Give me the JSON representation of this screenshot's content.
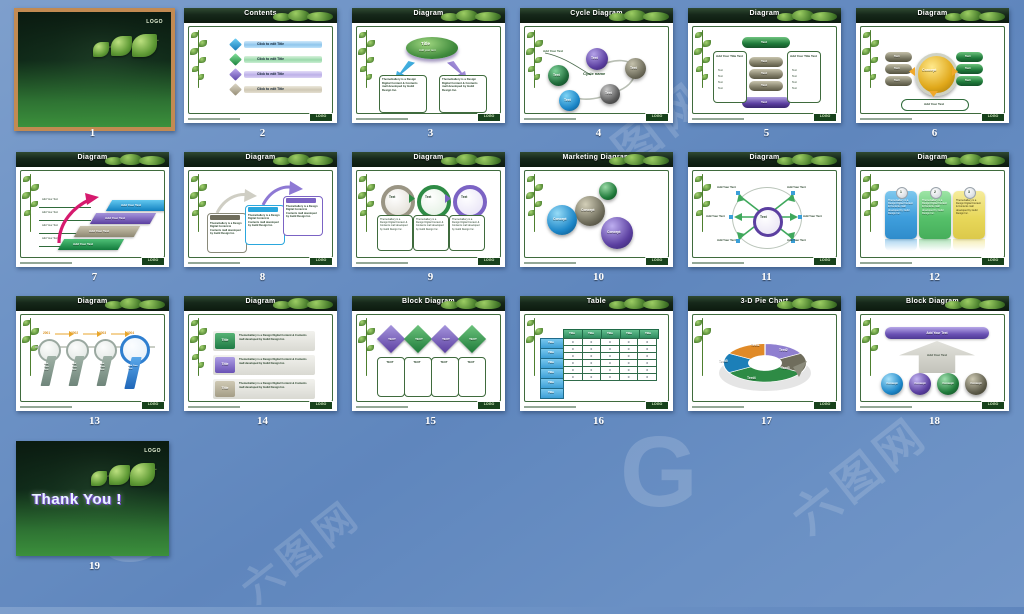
{
  "page": {
    "background_top": "#7e9fcc",
    "background_bottom": "#7296c8",
    "watermark_logo": "G",
    "watermark_text": "六图网"
  },
  "slides": [
    {
      "number": "1",
      "kind": "title",
      "selected": true,
      "logo_text": "LOGO",
      "title_text": ""
    },
    {
      "number": "2",
      "kind": "content",
      "title": "Contents",
      "logo": "LOGO",
      "items": [
        {
          "num": "1",
          "label": "Click to edit Title",
          "color": "#2e9fd8"
        },
        {
          "num": "2",
          "label": "Click to edit Title",
          "color": "#35b05a"
        },
        {
          "num": "3",
          "label": "Click to edit Title",
          "color": "#7b63c4"
        },
        {
          "num": "4",
          "label": "Click to edit Title",
          "color": "#b4ac96"
        }
      ]
    },
    {
      "number": "3",
      "kind": "diagram",
      "title": "Diagram",
      "logo": "LOGO",
      "center_title": "Title",
      "center_sub": "Add your text",
      "box_left": "ThemeGallery is a Design Digital Content & Contents mall developed by Guild Design Inc.",
      "box_right": "ThemeGallery is a Design Digital Content & Contents mall developed by Guild Design Inc."
    },
    {
      "number": "4",
      "kind": "cycle",
      "title": "Cycle Diagram",
      "logo": "LOGO",
      "cycle_label": "Cycle name",
      "add_text": "Add Your Text",
      "nodes": [
        {
          "label": "Text",
          "color": "#5b3fa0"
        },
        {
          "label": "Text",
          "color": "#6f6d5c"
        },
        {
          "label": "Text",
          "color": "#5a5a5a"
        },
        {
          "label": "Text",
          "color": "#1c86c8"
        },
        {
          "label": "Text",
          "color": "#1f6b3a"
        }
      ]
    },
    {
      "number": "5",
      "kind": "diagram",
      "title": "Diagram",
      "logo": "LOGO",
      "left_title": "Add Your Title Text",
      "right_title": "Add Your Title Text",
      "bullets": [
        "Text",
        "Text",
        "Text",
        "Text"
      ],
      "top_bar": "Text",
      "bottom_bar": "Text",
      "stack": [
        "Text",
        "Text",
        "Text"
      ]
    },
    {
      "number": "6",
      "kind": "diagram",
      "title": "Diagram",
      "logo": "LOGO",
      "concept": "Concept",
      "left_stack": [
        "Text",
        "Text",
        "Text"
      ],
      "right_stack": [
        "Text",
        "Text",
        "Text"
      ],
      "bottom": "Add Your Text"
    },
    {
      "number": "7",
      "kind": "diagram",
      "title": "Diagram",
      "logo": "LOGO",
      "steps": [
        {
          "label": "Add Your Text",
          "color": "#2aa7dd"
        },
        {
          "label": "Add Your Text",
          "color": "#7b63c4"
        },
        {
          "label": "Add Your Text",
          "color": "#a59f8c"
        },
        {
          "label": "Add Your Text",
          "color": "#1f8f4a"
        }
      ],
      "side_labels": [
        "Add Your Text",
        "Add Your Text",
        "Add Your Text",
        "Add Your Text"
      ]
    },
    {
      "number": "8",
      "kind": "diagram",
      "title": "Diagram",
      "logo": "LOGO",
      "cards": [
        {
          "header": "Add Your Title",
          "body": "ThemeGallery is a Design Digital Content & Contents mall developed by Guild Design Inc.",
          "color": "#8a8a7a"
        },
        {
          "header": "Add Your Title",
          "body": "ThemeGallery is a Design Digital Content & Contents mall developed by Guild Design Inc.",
          "color": "#2aa7dd"
        },
        {
          "header": "Add Your Title",
          "body": "ThemeGallery is a Design Digital Content & Contents mall developed by Guild Design Inc.",
          "color": "#7b63c4"
        }
      ]
    },
    {
      "number": "9",
      "kind": "diagram",
      "title": "Diagram",
      "logo": "LOGO",
      "rings": [
        {
          "label": "Text",
          "color": "#9a9584"
        },
        {
          "label": "Text",
          "color": "#2e8b45"
        },
        {
          "label": "Text",
          "color": "#7b63c4"
        }
      ],
      "texts": [
        "ThemeGallery is a Design Digital Content & Contents mall developed by Guild Design Inc.",
        "ThemeGallery is a Design Digital Content & Contents mall developed by Guild Design Inc.",
        "ThemeGallery is a Design Digital Content & Contents mall developed by Guild Design Inc."
      ]
    },
    {
      "number": "10",
      "kind": "marketing",
      "title": "Marketing Diagram",
      "logo": "LOGO",
      "spheres": [
        {
          "label": "Concept",
          "color": "#2aa7dd"
        },
        {
          "label": "Concept",
          "color": "#7a7463"
        },
        {
          "label": "Concept",
          "color": "#7b63c4"
        },
        {
          "label": "",
          "color": "#2e8b45"
        }
      ]
    },
    {
      "number": "11",
      "kind": "radial",
      "title": "Diagram",
      "logo": "LOGO",
      "center": "Text",
      "labels": [
        "Add Your Text",
        "Add Your Text",
        "Add Your Text",
        "Add Your Text",
        "Add Your Text",
        "Add Your Text"
      ]
    },
    {
      "number": "12",
      "kind": "cards",
      "title": "Diagram",
      "logo": "LOGO",
      "cards": [
        {
          "num": "1",
          "color": "#4aa9e8",
          "body": "ThemeGallery is a Design Digital Content & Contents mall developed by Guild Design Inc."
        },
        {
          "num": "2",
          "color": "#5ec46f",
          "body": "ThemeGallery is a Design Digital Content & Contents mall developed by Guild Design Inc."
        },
        {
          "num": "3",
          "color": "#e9d95c",
          "body": "ThemeGallery is a Design Digital Content & Contents mall developed by Guild Design Inc."
        }
      ]
    },
    {
      "number": "13",
      "kind": "timeline",
      "title": "Diagram",
      "logo": "LOGO",
      "years": [
        "2001",
        "2002",
        "2003",
        "2004"
      ],
      "handles": [
        "Add Your Text",
        "Add Your Text",
        "Add Your Text",
        "Add Your Text"
      ]
    },
    {
      "number": "14",
      "kind": "list",
      "title": "Diagram",
      "logo": "LOGO",
      "rows": [
        {
          "tag": "Title",
          "color": "#2e9a56",
          "text": "ThemeGallery is a Design Digital Content & Contents mall developed by Guild Design Inc."
        },
        {
          "tag": "Title",
          "color": "#8f7fd0",
          "text": "ThemeGallery is a Design Digital Content & Contents mall developed by Guild Design Inc."
        },
        {
          "tag": "Title",
          "color": "#b4ac96",
          "text": "ThemeGallery is a Design Digital Content & Contents mall developed by Guild Design Inc."
        }
      ]
    },
    {
      "number": "15",
      "kind": "block",
      "title": "Block Diagram",
      "logo": "LOGO",
      "diamonds": [
        {
          "label": "TEXT",
          "color": "#7b63c4"
        },
        {
          "label": "TEXT",
          "color": "#2e8b45"
        },
        {
          "label": "TEXT",
          "color": "#7b63c4"
        },
        {
          "label": "TEXT",
          "color": "#2e8b45"
        }
      ],
      "boxes": [
        "TEXT",
        "TEXT",
        "TEXT",
        "TEXT"
      ]
    },
    {
      "number": "16",
      "kind": "table",
      "title": "Table",
      "logo": "LOGO",
      "col_headers": [
        "Title",
        "Title",
        "Title",
        "Title",
        "Title"
      ],
      "row_headers": [
        "Title",
        "Title",
        "Title",
        "Title",
        "Title",
        "Title"
      ],
      "cells": [
        [
          "0",
          "0",
          "0",
          "0",
          "0"
        ],
        [
          "0",
          "0",
          "0",
          "0",
          "0"
        ],
        [
          "0",
          "0",
          "0",
          "0",
          "0"
        ],
        [
          "0",
          "0",
          "0",
          "0",
          "0"
        ],
        [
          "0",
          "0",
          "0",
          "0",
          "0"
        ],
        [
          "0",
          "0",
          "0",
          "0",
          "0"
        ]
      ]
    },
    {
      "number": "17",
      "kind": "pie",
      "title": "3-D Pie Chart",
      "logo": "LOGO",
      "segments": [
        {
          "label": "Text1",
          "color": "#e08a28",
          "value": 20
        },
        {
          "label": "Text2",
          "color": "#8f7fd0",
          "value": 20
        },
        {
          "label": "Text3",
          "color": "#6f6d5c",
          "value": 20
        },
        {
          "label": "Text4",
          "color": "#2e8b45",
          "value": 20
        },
        {
          "label": "Text5",
          "color": "#1c7fb8",
          "value": 20
        }
      ]
    },
    {
      "number": "18",
      "kind": "block",
      "title": "Block Diagram",
      "logo": "LOGO",
      "top_bar": "Add Your Text",
      "arrow_text": "Add Your Text",
      "spheres": [
        {
          "label": "Concept",
          "color": "#2aa7dd"
        },
        {
          "label": "Concept",
          "color": "#7b63c4"
        },
        {
          "label": "Concept",
          "color": "#2e8b45"
        },
        {
          "label": "Concept",
          "color": "#6f6d5c"
        }
      ]
    },
    {
      "number": "19",
      "kind": "title",
      "selected": false,
      "logo_text": "LOGO",
      "title_text": "Thank You !"
    }
  ]
}
